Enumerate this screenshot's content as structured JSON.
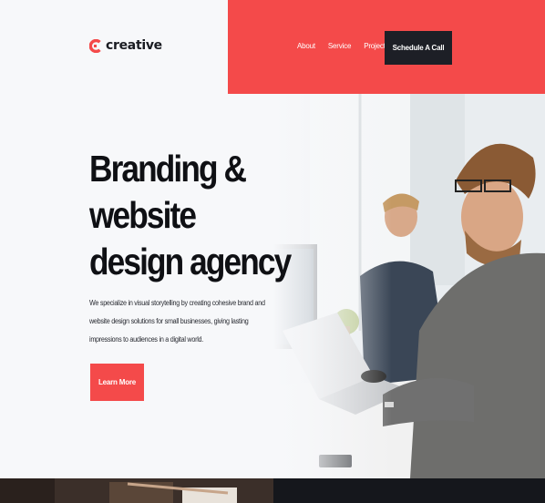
{
  "brand": {
    "name": "creative",
    "accent": "#f44a4a",
    "dark": "#1d1f26"
  },
  "nav": {
    "items": [
      {
        "label": "About"
      },
      {
        "label": "Service"
      },
      {
        "label": "Projects"
      }
    ]
  },
  "header": {
    "cta_label": "Schedule A Call"
  },
  "hero": {
    "headline": [
      "Branding &",
      "website",
      "design agency"
    ],
    "lead": [
      "We specialize in visual storytelling by creating cohesive brand and",
      "website design solutions for small businesses, giving lasting",
      "impressions to audiences in a digital world."
    ],
    "button_label": "Learn More"
  },
  "icons": {
    "logo": "c-logo-icon"
  }
}
